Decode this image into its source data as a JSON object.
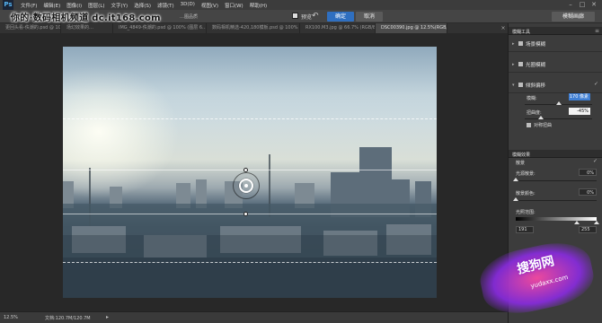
{
  "app": {
    "logo": "Ps"
  },
  "menu": {
    "items": [
      "文件(F)",
      "编辑(E)",
      "图像(I)",
      "图层(L)",
      "文字(Y)",
      "选择(S)",
      "滤镜(T)",
      "3D(D)",
      "视图(V)",
      "窗口(W)",
      "帮助(H)"
    ],
    "win_min": "–",
    "win_max": "□",
    "win_close": "✕"
  },
  "options": {
    "fragment": "…图品质",
    "checkbox_label": "预览",
    "undo_icon": "↶",
    "ok_label": "确定",
    "cancel_label": "取消",
    "gallery_label": "模糊画廊"
  },
  "watermark": {
    "text": "你的·数码相机频道 dc.it168.com"
  },
  "tabs": [
    {
      "label": "更回头看-佚潮的.psd @ 100% (…",
      "active": false
    },
    {
      "label": "场幻效果的…",
      "active": false
    },
    {
      "label": "IMG_4849-佚潮的.psd @ 100% (图层 6…",
      "active": false
    },
    {
      "label": "数码相机精选-420,180模板.psd @ 100% (图样…",
      "active": false
    },
    {
      "label": "RX100.M3.jpg @ 66.7% (RGB/8…",
      "active": false
    },
    {
      "label": "DSC00390.jpg @ 12.5%(RGB/8)",
      "active": true
    }
  ],
  "tab_close": "×",
  "status": {
    "zoom": "12.5%",
    "doc": "文档:120.7M/120.7M",
    "arrow": "▸"
  },
  "panel": {
    "header_title": "模糊工具",
    "header_menu": "≡",
    "rows": [
      {
        "label": "场景模糊",
        "arrow": "▸",
        "checked": false
      },
      {
        "label": "光圈模糊",
        "arrow": "▸",
        "checked": false
      },
      {
        "label": "倾斜偏移",
        "arrow": "▾",
        "checked": true
      }
    ],
    "check_mark": "✓",
    "blur_label": "模糊:",
    "blur_value": "170 像素",
    "distortion_label": "扭曲度:",
    "distortion_value": "-45%",
    "symmetric_label": "对称扭曲",
    "effects_title": "模糊效果",
    "bokeh_label": "散景",
    "light_bokeh_label": "光源散景:",
    "light_bokeh_value": "0%",
    "bokeh_color_label": "散景颜色:",
    "bokeh_color_value": "0%",
    "light_range_label": "光照范围:",
    "range_low": "191",
    "range_high": "255"
  },
  "badge": {
    "title": "搜狗网",
    "url": "yudaxx.com"
  },
  "colors": {
    "accent": "#2f6fc0",
    "badge": "#8a2be2"
  }
}
